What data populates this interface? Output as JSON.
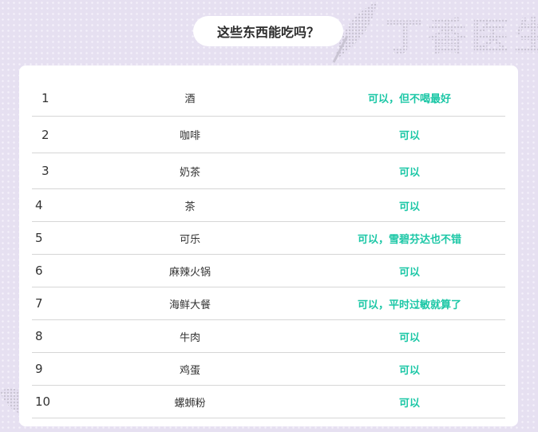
{
  "title": "这些东西能吃吗？",
  "watermark_text": "丁香医生",
  "colors": {
    "answer": "#1bc7a6",
    "background": "#e6e0f1",
    "divider": "#d6d6d6"
  },
  "rows": [
    {
      "num": "1",
      "item": "酒",
      "answer": "可以，但不喝最好"
    },
    {
      "num": "2",
      "item": "咖啡",
      "answer": "可以"
    },
    {
      "num": "3",
      "item": "奶茶",
      "answer": "可以"
    },
    {
      "num": "4",
      "item": "茶",
      "answer": "可以"
    },
    {
      "num": "5",
      "item": "可乐",
      "answer": "可以，雪碧芬达也不错"
    },
    {
      "num": "6",
      "item": "麻辣火锅",
      "answer": "可以"
    },
    {
      "num": "7",
      "item": "海鲜大餐",
      "answer": "可以，平时过敏就算了"
    },
    {
      "num": "8",
      "item": "牛肉",
      "answer": "可以"
    },
    {
      "num": "9",
      "item": "鸡蛋",
      "answer": "可以"
    },
    {
      "num": "10",
      "item": "螺蛳粉",
      "answer": "可以"
    }
  ]
}
